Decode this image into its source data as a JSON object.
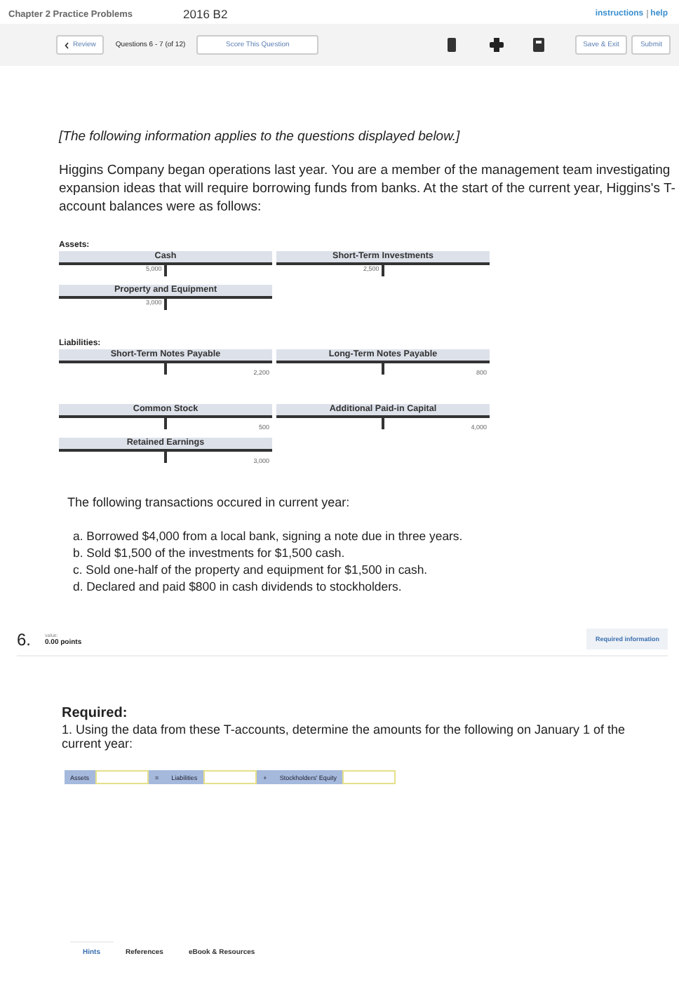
{
  "header": {
    "title": "Chapter 2 Practice Problems",
    "subtitle": "2016 B2",
    "links": [
      "instructions",
      "help"
    ]
  },
  "toolbar": {
    "review": "Review",
    "position": "Questions 6 - 7 (of 12)",
    "score": "Score This Question",
    "buttons": [
      "Save & Exit",
      "Submit"
    ]
  },
  "intro": "[The following information applies to the questions displayed below.]",
  "paragraph": "Higgins Company began operations last year. You are a member of the management team investigating expansion ideas that will require borrowing funds from banks. At the start of the current year, Higgins's T-account balances were as follows:",
  "groups": [
    {
      "label": "Assets:",
      "accounts": [
        {
          "name": "Cash",
          "kind": "debit",
          "amount": "5,000"
        },
        {
          "name": "Short-Term Investments",
          "kind": "debit",
          "amount": "2,500"
        },
        {
          "name": "Property and Equipment",
          "kind": "debit",
          "amount": "3,000"
        }
      ]
    },
    {
      "label": "Liabilities:",
      "accounts": [
        {
          "name": "Short-Term Notes Payable",
          "kind": "credit",
          "amount": "2,200"
        },
        {
          "name": "Long-Term Notes Payable",
          "kind": "credit",
          "amount": "800"
        }
      ]
    },
    {
      "accounts": [
        {
          "name": "Common Stock",
          "kind": "credit",
          "amount": "500"
        },
        {
          "name": "Additional Paid-in Capital",
          "kind": "credit",
          "amount": "4,000"
        },
        {
          "name": "Retained Earnings",
          "kind": "credit",
          "amount": "3,000"
        }
      ]
    }
  ],
  "transactions_intro": "The following transactions occured in current year:",
  "transactions": [
    "a. Borrowed $4,000 from a local bank, signing a note due in three years.",
    "b. Sold $1,500 of the investments for $1,500 cash.",
    "c. Sold one-half of the property and equipment for $1,500 in cash.",
    "d. Declared and paid $800 in cash dividends to stockholders."
  ],
  "question": {
    "number": "6.",
    "value_label": "value:",
    "points": "0.00 points",
    "badge": "Required information"
  },
  "required": {
    "heading": "Required:",
    "text": "1. Using the data from these T-accounts, determine the amounts for the following on January 1 of the current year:"
  },
  "equation": [
    {
      "kind": "label",
      "text": "Assets"
    },
    {
      "kind": "input"
    },
    {
      "kind": "operator",
      "text": "="
    },
    {
      "kind": "label",
      "text": "Liabilities"
    },
    {
      "kind": "input"
    },
    {
      "kind": "operator",
      "text": "+"
    },
    {
      "kind": "label",
      "text": "Stockholders' Equity"
    },
    {
      "kind": "input"
    }
  ],
  "tabs": [
    {
      "label": "Hints",
      "selected": true
    },
    {
      "label": "References",
      "selected": false
    },
    {
      "label": "eBook & Resources",
      "selected": false
    }
  ]
}
